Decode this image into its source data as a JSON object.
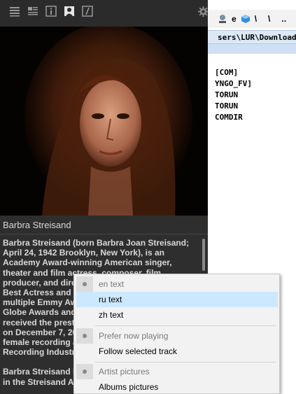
{
  "background_window": {
    "toolbar_glyphs": [
      "e",
      "\\",
      "\\",
      ".."
    ],
    "path_text": "sers\\LUR\\Downloads",
    "list_items": [
      "[COM]",
      "YNGO_FV]",
      "TORUN",
      "TORUN",
      "COMDIR"
    ]
  },
  "panel": {
    "toolbar_icons": [
      "list-view-icon",
      "detail-view-icon",
      "info-icon",
      "artist-icon",
      "lyrics-icon",
      "settings-gear-icon"
    ],
    "artist_name": "Barbra Streisand",
    "bio_paragraphs": [
      "Barbra Streisand (born Barbra Joan Streisand; April 24, 1942 Brooklyn, New York), is an Academy Award-winning American singer, theater and film actress, composer, film producer, and dire",
      "Barbra Streisand I albums, almost all early works in the Streisand Album w"
    ],
    "bio_hidden_lines": [
      "Best Actress and B",
      "multiple Emmy Aw",
      "Globe Awards and",
      "received the prest",
      "on December 7, 20",
      "female recording a",
      "Recording Industr"
    ]
  },
  "menu": {
    "items": [
      {
        "label": "en text",
        "state": "checked-disabled"
      },
      {
        "label": "ru text",
        "state": "selected"
      },
      {
        "label": "zh text",
        "state": "normal"
      },
      {
        "label": "Prefer now playing",
        "state": "checked-disabled"
      },
      {
        "label": "Follow selected track",
        "state": "normal"
      },
      {
        "label": "Artist pictures",
        "state": "checked-disabled"
      },
      {
        "label": "Albums pictures",
        "state": "normal"
      }
    ]
  }
}
